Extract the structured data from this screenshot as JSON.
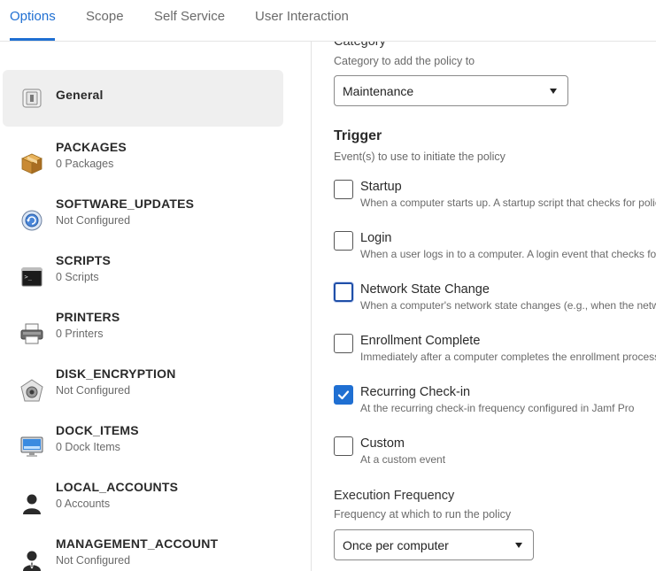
{
  "tabs": [
    {
      "label": "Options",
      "active": true
    },
    {
      "label": "Scope",
      "active": false
    },
    {
      "label": "Self Service",
      "active": false
    },
    {
      "label": "User Interaction",
      "active": false
    }
  ],
  "sidebar": {
    "items": [
      {
        "title": "General",
        "subtitle": "",
        "icon": "general-icon",
        "selected": true
      },
      {
        "title": "PACKAGES",
        "subtitle": "0 Packages",
        "icon": "package-icon"
      },
      {
        "title": "SOFTWARE_UPDATES",
        "subtitle": "Not Configured",
        "icon": "software-update-icon"
      },
      {
        "title": "SCRIPTS",
        "subtitle": "0 Scripts",
        "icon": "terminal-icon"
      },
      {
        "title": "PRINTERS",
        "subtitle": "0 Printers",
        "icon": "printer-icon"
      },
      {
        "title": "DISK_ENCRYPTION",
        "subtitle": "Not Configured",
        "icon": "disk-encryption-icon"
      },
      {
        "title": "DOCK_ITEMS",
        "subtitle": "0 Dock Items",
        "icon": "monitor-icon"
      },
      {
        "title": "LOCAL_ACCOUNTS",
        "subtitle": "0 Accounts",
        "icon": "user-silhouette-icon"
      },
      {
        "title": "MANAGEMENT_ACCOUNT",
        "subtitle": "Not Configured",
        "icon": "admin-user-icon"
      }
    ]
  },
  "main": {
    "category": {
      "heading": "Category",
      "description": "Category to add the policy to",
      "value": "Maintenance"
    },
    "trigger": {
      "heading": "Trigger",
      "description": "Event(s) to use to initiate the policy",
      "options": [
        {
          "label": "Startup",
          "description": "When a computer starts up. A startup script that checks for policies must also be configured",
          "checked": false
        },
        {
          "label": "Login",
          "description": "When a user logs in to a computer. A login event that checks for policies must also be configured",
          "checked": false
        },
        {
          "label": "Network State Change",
          "description": "When a computer's network state changes (e.g., when the network connection changes)",
          "checked": false,
          "focused": true
        },
        {
          "label": "Enrollment Complete",
          "description": "Immediately after a computer completes the enrollment process",
          "checked": false
        },
        {
          "label": "Recurring Check-in",
          "description": "At the recurring check-in frequency configured in Jamf Pro",
          "checked": true
        },
        {
          "label": "Custom",
          "description": "At a custom event",
          "checked": false
        }
      ]
    },
    "execution_frequency": {
      "heading": "Execution Frequency",
      "description": "Frequency at which to run the policy",
      "value": "Once per computer"
    }
  },
  "colors": {
    "accent": "#1f6fd2",
    "selected_bg": "#efefef",
    "focus_border": "#1f4fa8"
  }
}
